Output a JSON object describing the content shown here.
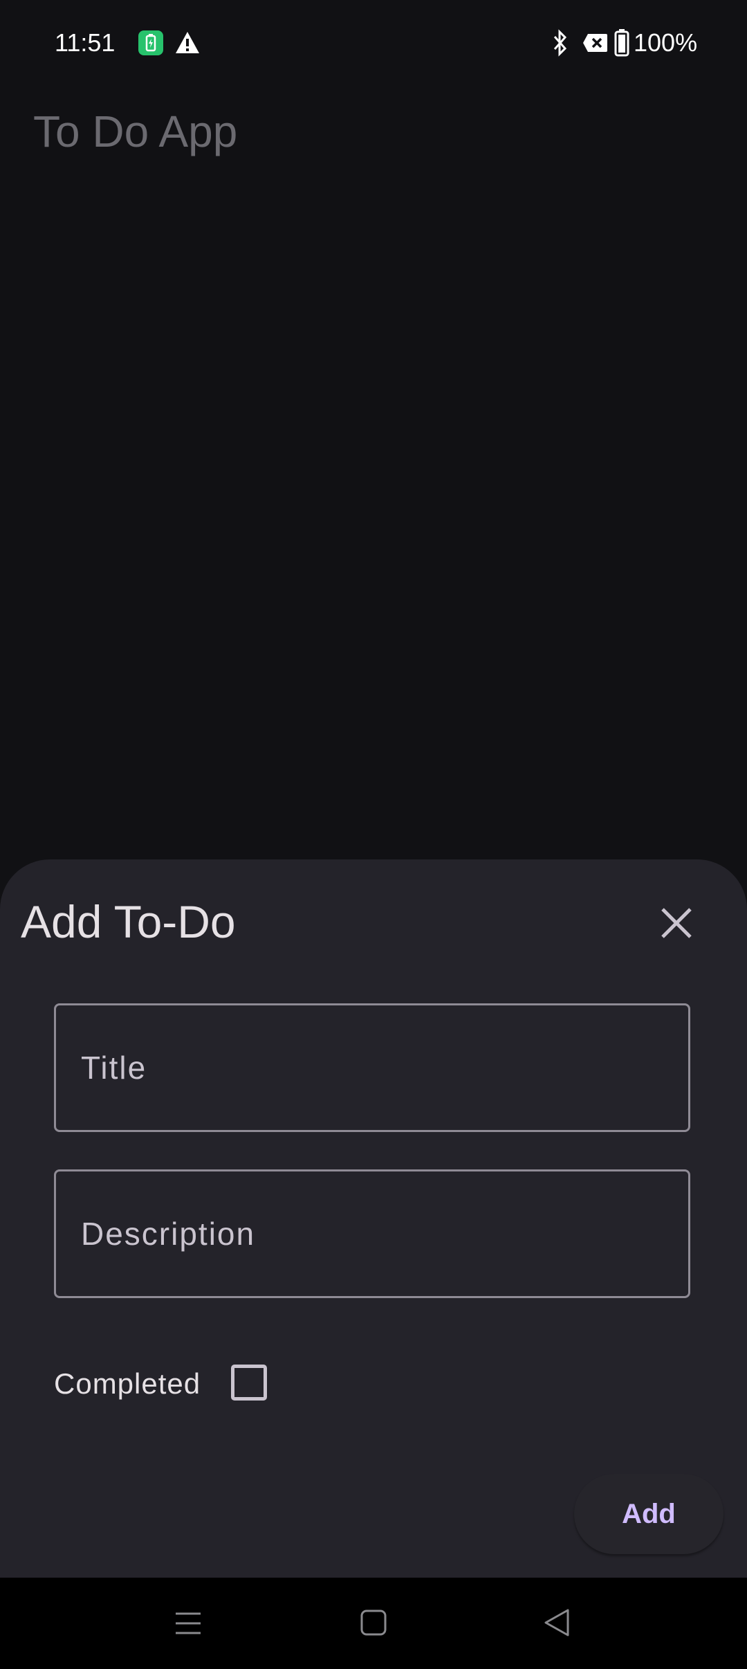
{
  "status_bar": {
    "time": "11:51",
    "battery_percent": "100%",
    "icons": [
      "battery-charging-icon",
      "warning-icon",
      "bluetooth-icon",
      "no-sim-icon",
      "battery-icon"
    ]
  },
  "app": {
    "title": "To Do App"
  },
  "sheet": {
    "title": "Add To-Do",
    "close_icon": "close-icon",
    "title_field": {
      "placeholder": "Title",
      "value": ""
    },
    "description_field": {
      "placeholder": "Description",
      "value": ""
    },
    "completed_label": "Completed",
    "completed_checked": false,
    "add_label": "Add"
  },
  "nav_bar": {
    "icons": [
      "menu-icon",
      "home-icon",
      "back-icon"
    ]
  },
  "colors": {
    "background": "#111114",
    "sheet": "#24232a",
    "accent": "#d0bcff",
    "charging_green": "#27c26c"
  }
}
